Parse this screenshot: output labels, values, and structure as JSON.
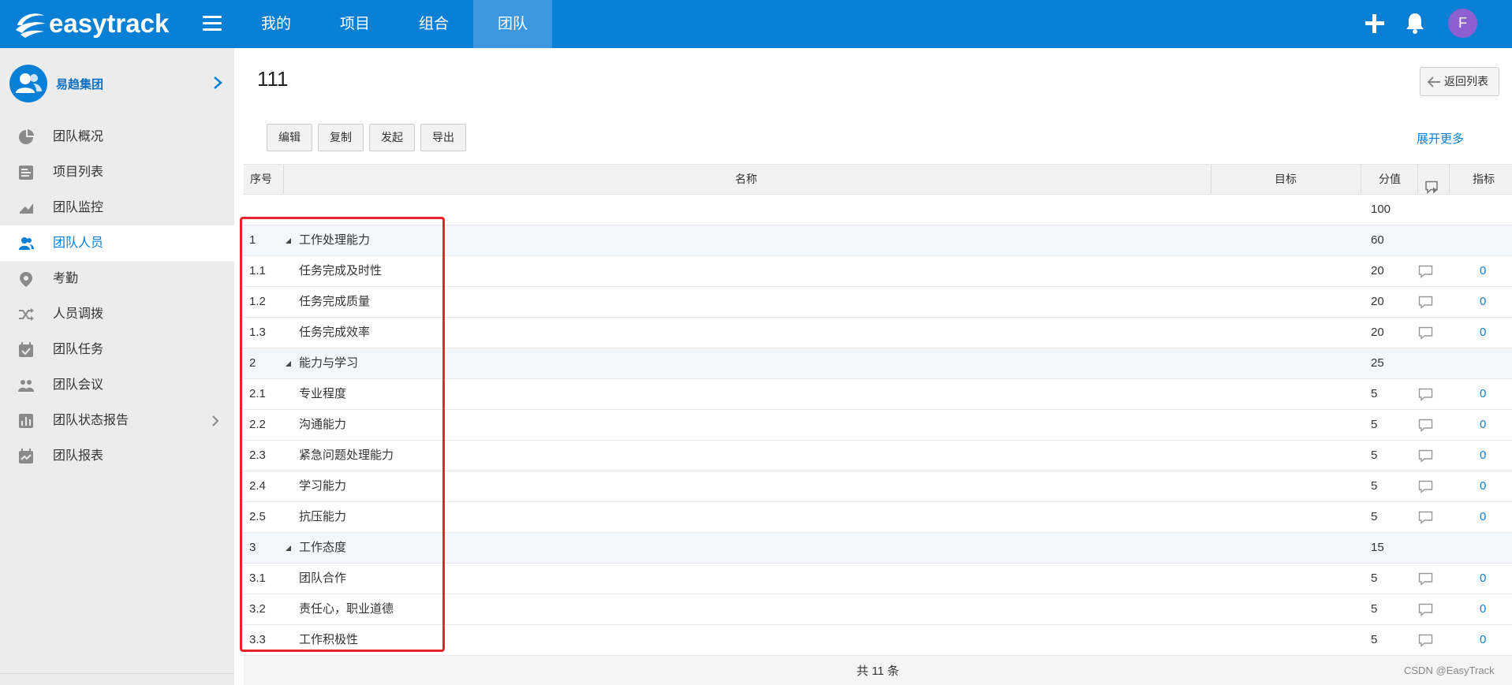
{
  "app": {
    "logo_text": "easytrack"
  },
  "nav": {
    "items": [
      "我的",
      "项目",
      "组合",
      "团队"
    ],
    "active_index": 3
  },
  "user": {
    "avatar_letter": "F"
  },
  "sidebar": {
    "org_name": "易趋集团",
    "items": [
      {
        "label": "团队概况",
        "icon": "pie-chart-icon"
      },
      {
        "label": "项目列表",
        "icon": "list-icon"
      },
      {
        "label": "团队监控",
        "icon": "monitor-icon"
      },
      {
        "label": "团队人员",
        "icon": "people-icon",
        "active": true
      },
      {
        "label": "考勤",
        "icon": "location-icon"
      },
      {
        "label": "人员调拨",
        "icon": "shuffle-icon"
      },
      {
        "label": "团队任务",
        "icon": "calendar-check-icon"
      },
      {
        "label": "团队会议",
        "icon": "meeting-icon"
      },
      {
        "label": "团队状态报告",
        "icon": "bar-chart-icon",
        "has_arrow": true
      },
      {
        "label": "团队报表",
        "icon": "report-icon"
      }
    ]
  },
  "page": {
    "title": "111",
    "back_label": "返回列表",
    "toolbar": {
      "edit": "编辑",
      "copy": "复制",
      "launch": "发起",
      "export": "导出"
    },
    "expand_more": "展开更多"
  },
  "table": {
    "headers": {
      "index": "序号",
      "name": "名称",
      "target": "目标",
      "score": "分值",
      "metric": "指标"
    },
    "total_row": {
      "score": "100"
    },
    "rows": [
      {
        "idx": "1",
        "name": "工作处理能力",
        "score": "60",
        "group": true
      },
      {
        "idx": "1.1",
        "name": "任务完成及时性",
        "score": "20",
        "metric": "0"
      },
      {
        "idx": "1.2",
        "name": "任务完成质量",
        "score": "20",
        "metric": "0"
      },
      {
        "idx": "1.3",
        "name": "任务完成效率",
        "score": "20",
        "metric": "0"
      },
      {
        "idx": "2",
        "name": "能力与学习",
        "score": "25",
        "group": true
      },
      {
        "idx": "2.1",
        "name": "专业程度",
        "score": "5",
        "metric": "0"
      },
      {
        "idx": "2.2",
        "name": "沟通能力",
        "score": "5",
        "metric": "0"
      },
      {
        "idx": "2.3",
        "name": "紧急问题处理能力",
        "score": "5",
        "metric": "0"
      },
      {
        "idx": "2.4",
        "name": "学习能力",
        "score": "5",
        "metric": "0"
      },
      {
        "idx": "2.5",
        "name": "抗压能力",
        "score": "5",
        "metric": "0"
      },
      {
        "idx": "3",
        "name": "工作态度",
        "score": "15",
        "group": true
      },
      {
        "idx": "3.1",
        "name": "团队合作",
        "score": "5",
        "metric": "0"
      },
      {
        "idx": "3.2",
        "name": "责任心，职业道德",
        "score": "5",
        "metric": "0"
      },
      {
        "idx": "3.3",
        "name": "工作积极性",
        "score": "5",
        "metric": "0"
      }
    ],
    "footer": "共 11 条"
  },
  "watermark": "CSDN @EasyTrack",
  "colors": {
    "brand": "#0a7fd6",
    "highlight": "#e8242a",
    "avatar": "#8e5fd1"
  }
}
